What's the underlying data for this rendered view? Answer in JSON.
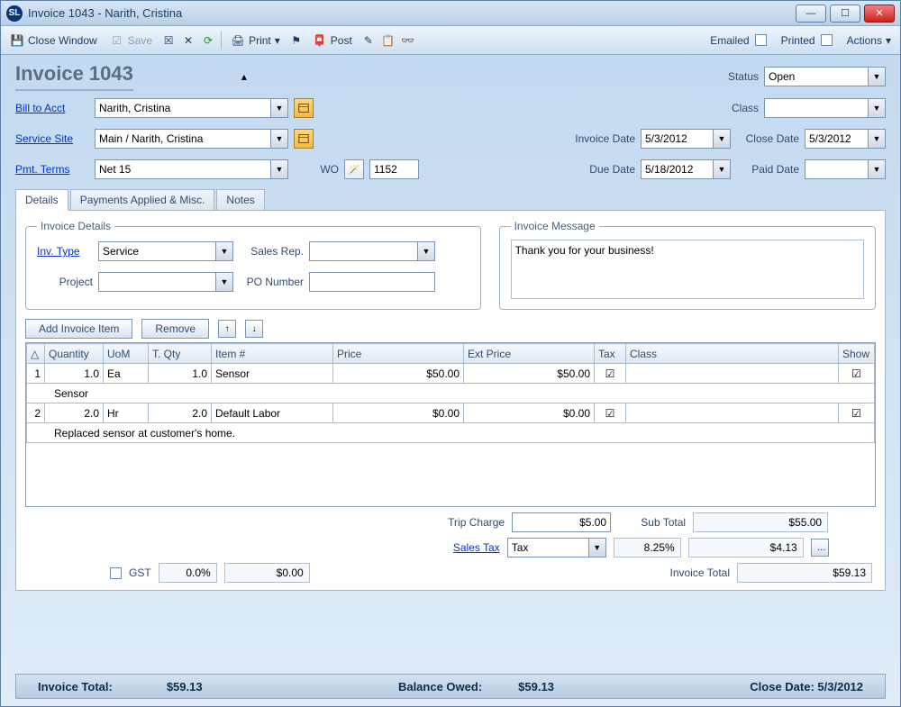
{
  "window": {
    "title": "Invoice 1043 - Narith, Cristina"
  },
  "toolbar": {
    "close_window": "Close Window",
    "save": "Save",
    "print": "Print",
    "post": "Post",
    "emailed": "Emailed",
    "printed": "Printed",
    "actions": "Actions"
  },
  "header": {
    "title": "Invoice 1043",
    "status_label": "Status",
    "status": "Open",
    "bill_to_label": "Bill to Acct",
    "bill_to": "Narith, Cristina",
    "class_label": "Class",
    "class": "",
    "service_site_label": "Service Site",
    "service_site": "Main / Narith, Cristina",
    "invoice_date_label": "Invoice Date",
    "invoice_date": "5/3/2012",
    "close_date_label": "Close Date",
    "close_date": "5/3/2012",
    "pmt_terms_label": "Pmt. Terms",
    "pmt_terms": "Net 15",
    "wo_label": "WO",
    "wo": "1152",
    "due_date_label": "Due Date",
    "due_date": "5/18/2012",
    "paid_date_label": "Paid Date",
    "paid_date": ""
  },
  "tabs": {
    "details": "Details",
    "payments": "Payments Applied & Misc.",
    "notes": "Notes"
  },
  "details": {
    "legend": "Invoice Details",
    "inv_type_label": "Inv. Type",
    "inv_type": "Service",
    "sales_rep_label": "Sales Rep.",
    "sales_rep": "",
    "project_label": "Project",
    "project": "",
    "po_label": "PO Number",
    "po": ""
  },
  "message": {
    "legend": "Invoice Message",
    "text": "Thank you for your business!"
  },
  "grid": {
    "add_btn": "Add Invoice Item",
    "remove_btn": "Remove",
    "cols": {
      "expand": "△",
      "quantity": "Quantity",
      "uom": "UoM",
      "tqty": "T. Qty",
      "item": "Item #",
      "price": "Price",
      "ext_price": "Ext Price",
      "tax": "Tax",
      "class": "Class",
      "show": "Show"
    },
    "rows": [
      {
        "n": "1",
        "qty": "1.0",
        "uom": "Ea",
        "tqty": "1.0",
        "item": "Sensor",
        "price": "$50.00",
        "ext": "$50.00",
        "tax": true,
        "class": "",
        "show": true,
        "desc": "Sensor"
      },
      {
        "n": "2",
        "qty": "2.0",
        "uom": "Hr",
        "tqty": "2.0",
        "item": "Default Labor",
        "price": "$0.00",
        "ext": "$0.00",
        "tax": true,
        "class": "",
        "show": true,
        "desc": "Replaced sensor at customer's home."
      }
    ]
  },
  "totals": {
    "trip_charge_label": "Trip Charge",
    "trip_charge": "$5.00",
    "sub_total_label": "Sub Total",
    "sub_total": "$55.00",
    "sales_tax_label": "Sales Tax",
    "sales_tax_type": "Tax",
    "sales_tax_rate": "8.25%",
    "sales_tax_amt": "$4.13",
    "gst_label": "GST",
    "gst_rate": "0.0%",
    "gst_amt": "$0.00",
    "invoice_total_label": "Invoice Total",
    "invoice_total": "$59.13"
  },
  "statusbar": {
    "invoice_total_label": "Invoice Total:",
    "invoice_total": "$59.13",
    "balance_label": "Balance Owed:",
    "balance": "$59.13",
    "close_date_label": "Close Date: 5/3/2012"
  }
}
